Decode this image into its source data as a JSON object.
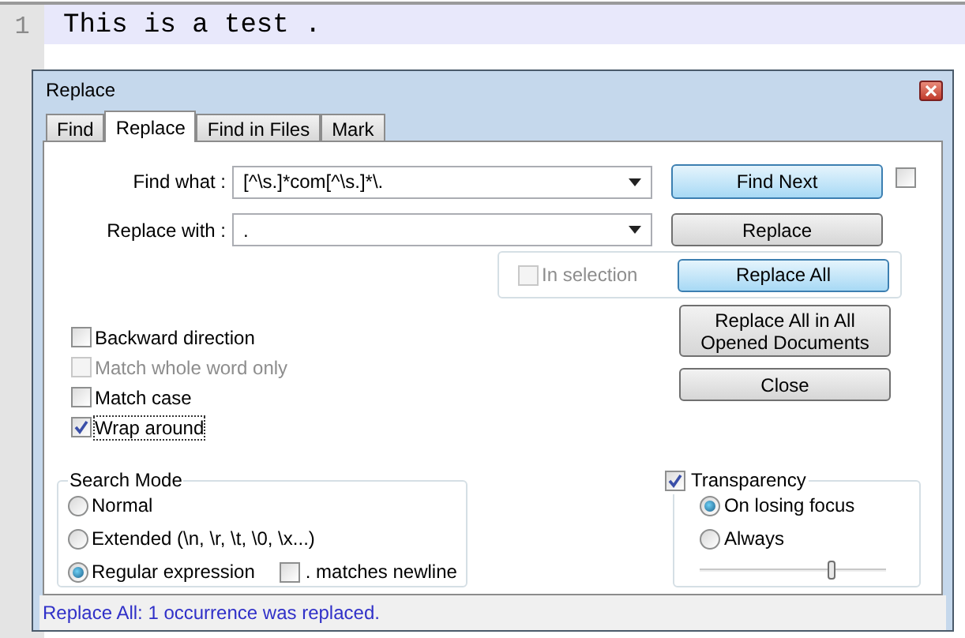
{
  "editor": {
    "line_number": "1",
    "line_text": "This is a test ."
  },
  "dialog": {
    "title": "Replace",
    "tabs": [
      {
        "label": "Find",
        "selected": false
      },
      {
        "label": "Replace",
        "selected": true
      },
      {
        "label": "Find in Files",
        "selected": false
      },
      {
        "label": "Mark",
        "selected": false
      }
    ],
    "find_what": {
      "label": "Find what :",
      "value": "[^\\s.]*com[^\\s.]*\\."
    },
    "replace_with": {
      "label": "Replace with :",
      "value": "."
    },
    "side_checkbox": {
      "checked": false
    },
    "in_selection": {
      "label": "In selection",
      "checked": false,
      "disabled": true
    },
    "buttons": [
      {
        "label": "Find Next",
        "highlighted": true
      },
      {
        "label": "Replace",
        "highlighted": false
      },
      {
        "label": "Replace All",
        "highlighted": true
      },
      {
        "label": "Replace All in All Opened Documents",
        "highlighted": false
      },
      {
        "label": "Close",
        "highlighted": false
      }
    ],
    "options": [
      {
        "label": "Backward direction",
        "checked": false,
        "disabled": false,
        "focused": false
      },
      {
        "label": "Match whole word only",
        "checked": false,
        "disabled": true,
        "focused": false
      },
      {
        "label": "Match case",
        "checked": false,
        "disabled": false,
        "focused": false
      },
      {
        "label": "Wrap around",
        "checked": true,
        "disabled": false,
        "focused": true
      }
    ],
    "search_mode": {
      "title": "Search Mode",
      "modes": [
        {
          "label": "Normal",
          "selected": false
        },
        {
          "label": "Extended (\\n, \\r, \\t, \\0, \\x...)",
          "selected": false
        },
        {
          "label": "Regular expression",
          "selected": true
        }
      ],
      "dot_matches_newline": {
        "label": ". matches newline",
        "checked": false
      }
    },
    "transparency": {
      "label": "Transparency",
      "checked": true,
      "modes": [
        {
          "label": "On losing focus",
          "selected": true
        },
        {
          "label": "Always",
          "selected": false
        }
      ],
      "level": 0.71
    },
    "status": "Replace All: 1 occurrence was replaced."
  }
}
